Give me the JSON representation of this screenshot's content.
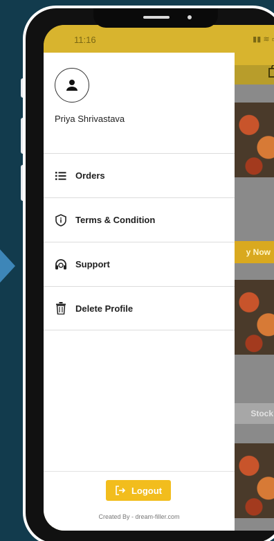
{
  "status_bar": {
    "time": "11:16"
  },
  "drawer": {
    "user_name": "Priya Shrivastava",
    "menu": [
      {
        "label": "Orders",
        "icon": "list-icon"
      },
      {
        "label": "Terms & Condition",
        "icon": "info-icon"
      },
      {
        "label": "Support",
        "icon": "headset-icon"
      },
      {
        "label": "Delete Profile",
        "icon": "trash-icon"
      }
    ],
    "logout_label": "Logout",
    "credit": "Created By - dream-filler.com"
  },
  "background_app": {
    "buy_label": "y Now",
    "stock_label": "Stock"
  },
  "colors": {
    "accent": "#f2bd1d",
    "background": "#123b4d",
    "pointer": "#3d86b8"
  }
}
